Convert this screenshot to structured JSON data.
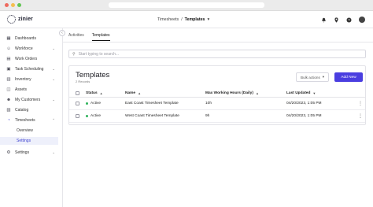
{
  "app": {
    "logo_text": "zinier",
    "accent_color": "#4a3ee0",
    "active_color": "#3b3fd0"
  },
  "header": {
    "breadcrumb_parent": "Timesheets",
    "breadcrumb_sep": "/",
    "breadcrumb_current": "Templates",
    "breadcrumb_chevron": "▾",
    "icons": [
      "bell-icon",
      "location-pin-icon",
      "help-icon",
      "avatar"
    ]
  },
  "sidebar": {
    "items": [
      {
        "label": "Dashboards",
        "icon": "dashboard-icon",
        "glyph": "▦",
        "chevron": ""
      },
      {
        "label": "Workforce",
        "icon": "workforce-icon",
        "glyph": "☺",
        "chevron": "⌄"
      },
      {
        "label": "Work Orders",
        "icon": "work-orders-icon",
        "glyph": "▤",
        "chevron": ""
      },
      {
        "label": "Task Scheduling",
        "icon": "calendar-icon",
        "glyph": "▣",
        "chevron": "⌄"
      },
      {
        "label": "Inventory",
        "icon": "inventory-icon",
        "glyph": "▥",
        "chevron": "⌄"
      },
      {
        "label": "Assets",
        "icon": "assets-icon",
        "glyph": "◫",
        "chevron": ""
      },
      {
        "label": "My Customers",
        "icon": "customers-icon",
        "glyph": "☻",
        "chevron": "⌄"
      },
      {
        "label": "Catalog",
        "icon": "catalog-icon",
        "glyph": "▧",
        "chevron": ""
      },
      {
        "label": "Timesheets",
        "icon": "timesheets-icon",
        "glyph": "◔",
        "chevron": "⌃"
      }
    ],
    "sub_items": [
      {
        "label": "Overview",
        "active": false
      },
      {
        "label": "Settings",
        "active": true
      }
    ],
    "bottom_item": {
      "label": "Settings",
      "icon": "gear-icon",
      "glyph": "⚙",
      "chevron": "⌄"
    },
    "collapse_glyph": "‹"
  },
  "tabs": [
    {
      "label": "Activities",
      "active": false
    },
    {
      "label": "Templates",
      "active": true
    }
  ],
  "search": {
    "placeholder": "Start typing to search...",
    "icon": "search-icon",
    "glyph": "⚲"
  },
  "card": {
    "title": "Templates",
    "subtitle": "2 Records",
    "bulk_actions_label": "Bulk actions",
    "bulk_actions_chevron": "▾",
    "add_new_label": "Add New"
  },
  "table": {
    "columns": [
      {
        "label": "Status",
        "sort": "▲"
      },
      {
        "label": "Name",
        "sort": "▲"
      },
      {
        "label": "Max Working Hours (Daily)",
        "sort": "▲"
      },
      {
        "label": "Last Updated",
        "sort": "▼"
      }
    ],
    "rows": [
      {
        "status": "Active",
        "name": "East Coast Timesheet Template",
        "max_hours": "10h",
        "last_updated": "04/20/2023, 1:05 PM"
      },
      {
        "status": "Active",
        "name": "West Coast Timesheet Template",
        "max_hours": "9h",
        "last_updated": "04/20/2023, 1:05 PM"
      }
    ],
    "status_active_color": "#2fb35b"
  }
}
